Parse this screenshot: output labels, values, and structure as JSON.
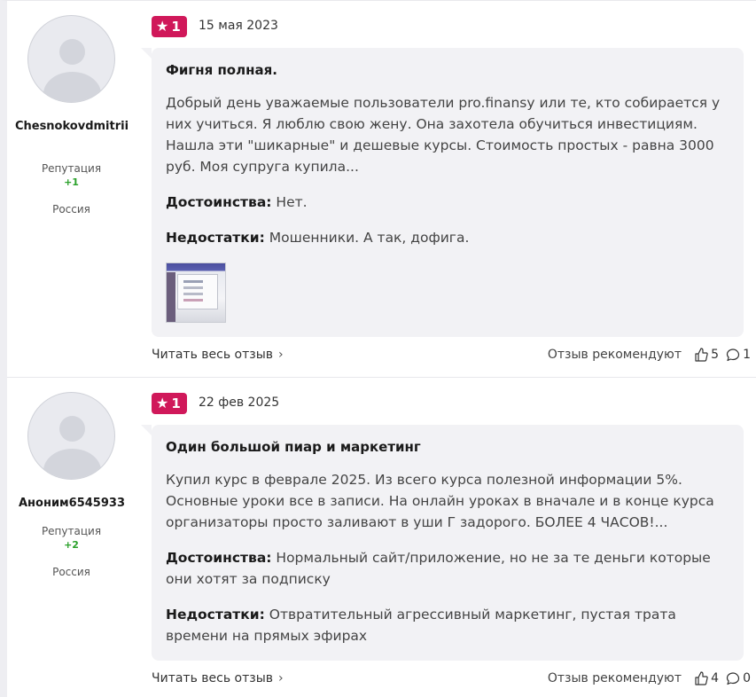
{
  "reviews": [
    {
      "author": "Chesnokovdmitrii",
      "reputation_label": "Репутация",
      "reputation_value": "+1",
      "country": "Россия",
      "rating": "1",
      "date": "15 мая 2023",
      "title": "Фигня полная.",
      "text": "Добрый день уважаемые пользователи pro.finansy или те, кто собирается у них учиться. Я люблю свою жену. Она захотела обучиться инвестициям. Нашла эти \"шикарные\" и дешевые курсы. Стоимость простых - равна 3000 руб. Моя супруга купила...",
      "pros_label": "Достоинства:",
      "pros": "Нет.",
      "cons_label": "Недостатки:",
      "cons": "Мошенники. А так, дофига.",
      "read_more": "Читать весь отзыв",
      "recommend_label": "Отзыв рекомендуют",
      "likes": "5",
      "comments": "1"
    },
    {
      "author": "Аноним6545933",
      "reputation_label": "Репутация",
      "reputation_value": "+2",
      "country": "Россия",
      "rating": "1",
      "date": "22 фев 2025",
      "title": "Один большой пиар и маркетинг",
      "text": "Купил курс в феврале 2025. Из всего курса полезной информации 5%. Основные уроки все в записи. На онлайн уроках в вначале и в конце курса организаторы просто заливают в уши Г задорого. БОЛЕЕ 4 ЧАСОВ!...",
      "pros_label": "Достоинства:",
      "pros": "Нормальный сайт/приложение, но не за те деньги которые они хотят за подписку",
      "cons_label": "Недостатки:",
      "cons": "Отвратительный агрессивный маркетинг, пустая трата времени на прямых эфирах",
      "read_more": "Читать весь отзыв",
      "recommend_label": "Отзыв рекомендуют",
      "likes": "4",
      "comments": "0"
    }
  ],
  "colors": {
    "rating_badge": "#d0185a",
    "bubble": "#f2f2f5",
    "reputation": "#2aa12a"
  },
  "icons": [
    "star-icon",
    "thumbs-up-icon",
    "comment-icon",
    "chevron-right-icon",
    "avatar-placeholder-icon"
  ]
}
